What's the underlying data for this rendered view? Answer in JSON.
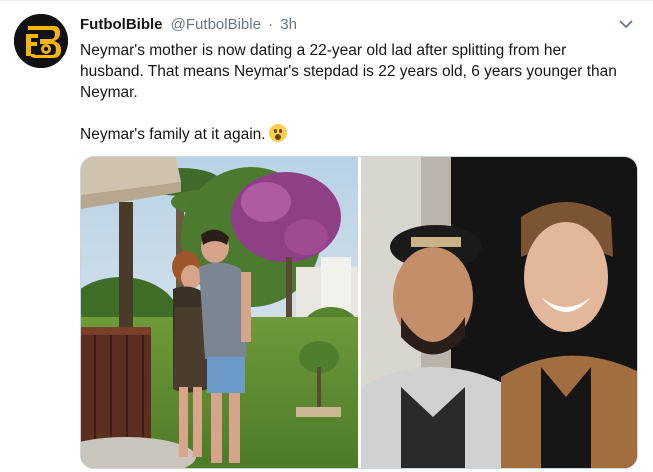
{
  "tweet": {
    "author_name": "FutbolBible",
    "author_handle": "@FutbolBible",
    "separator": "·",
    "time": "3h",
    "text_line_1": "Neymar's mother is now dating a 22-year old lad after splitting from her husband. That means Neymar's stepdad is 22 years old, 6 years younger than Neymar.",
    "text_line_2": "Neymar's family at it again.",
    "emoji": "astonished-face",
    "avatar_icon": "futbolbible-logo-icon",
    "menu_icon": "chevron-down-icon"
  },
  "colors": {
    "text": "#14171a",
    "secondary": "#657786",
    "border": "#e6ecf0",
    "media_border": "#ccd6dd",
    "logo_yellow": "#f6b40e"
  }
}
